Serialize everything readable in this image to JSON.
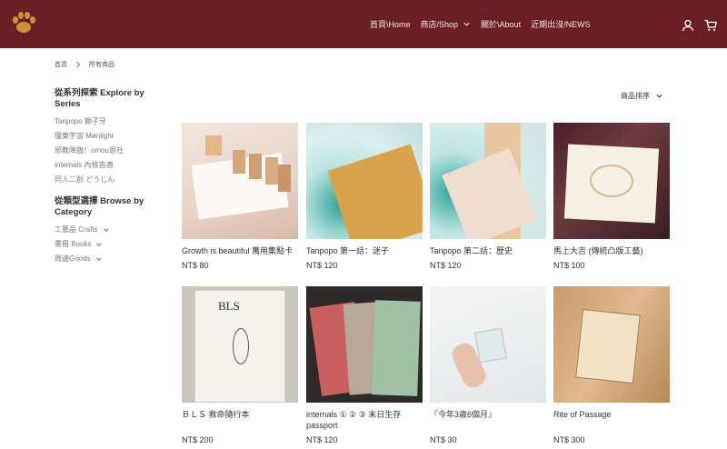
{
  "header": {
    "logo_name": "paw-logo",
    "nav": [
      {
        "label": "首頁\\Home",
        "dropdown": false
      },
      {
        "label": "商店/Shop",
        "dropdown": true
      },
      {
        "label": "關於\\About",
        "dropdown": false
      },
      {
        "label": "近期出沒/NEWS",
        "dropdown": false
      }
    ],
    "icons": [
      "user-icon",
      "cart-icon"
    ],
    "bg_color": "#6b1f25"
  },
  "breadcrumb": {
    "home": "首頁",
    "current": "所有商品"
  },
  "sidebar": {
    "series_heading": "從系列探索 Explore by Series",
    "series": [
      "Tanpopo 獅子牙",
      "慢東宇宙 Mønlight",
      "邪教降臨！omou恩社",
      "internals 內核自適",
      "同人二創 どうじん"
    ],
    "category_heading": "從類型選擇 Browse by Category",
    "categories": [
      "工藝品 Crafts",
      "書冊 Books",
      "周邊Goods"
    ]
  },
  "sort": {
    "label": "商品排序"
  },
  "products": [
    {
      "name": "Growth is beautiful 萬用集點卡",
      "price": "NT$ 80"
    },
    {
      "name": "Tanpopo 第一話：迷子",
      "price": "NT$ 120"
    },
    {
      "name": "Tanpopo 第二話：歷史",
      "price": "NT$ 120"
    },
    {
      "name": "馬上大吉 (傳統凸版工藝)",
      "price": "NT$ 100"
    },
    {
      "name": "ＢＬＳ 救命隨行本",
      "price": "NT$ 200"
    },
    {
      "name": "internals ① ② ③ 末日生存passport",
      "price": "NT$ 120"
    },
    {
      "name": "『今年3歲6個月』",
      "price": "NT$ 30"
    },
    {
      "name": "Rite of Passage",
      "price": "NT$ 300"
    }
  ]
}
